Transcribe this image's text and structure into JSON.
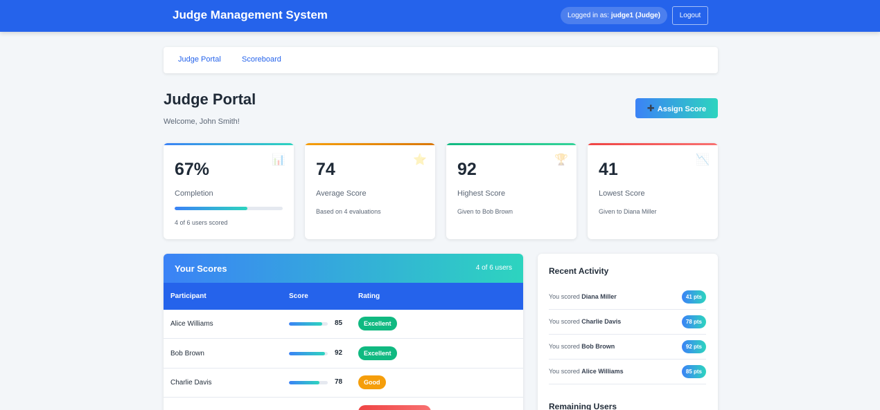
{
  "header": {
    "title": "Judge Management System",
    "logged_in_prefix": "Logged in as:",
    "user": "judge1 (Judge)",
    "logout_label": "Logout"
  },
  "nav": {
    "items": [
      "Judge Portal",
      "Scoreboard"
    ]
  },
  "page": {
    "title": "Judge Portal",
    "welcome": "Welcome, John Smith!",
    "assign_label": "Assign Score",
    "assign_icon": "plus-icon"
  },
  "stats": [
    {
      "value": "67%",
      "label": "Completion",
      "sub": "4 of 6 users scored",
      "icon": "bar-chart-icon",
      "progress": 0.67,
      "accent": "#3b82f6"
    },
    {
      "value": "74",
      "label": "Average Score",
      "sub": "Based on 4 evaluations",
      "icon": "star-icon",
      "accent": "#f59e0b"
    },
    {
      "value": "92",
      "label": "Highest Score",
      "sub": "Given to Bob Brown",
      "icon": "trophy-icon",
      "accent": "#10b981"
    },
    {
      "value": "41",
      "label": "Lowest Score",
      "sub": "Given to Diana Miller",
      "icon": "trend-down-icon",
      "accent": "#ef4444"
    }
  ],
  "scores": {
    "title": "Your Scores",
    "count": "4 of 6 users",
    "columns": [
      "Participant",
      "Score",
      "Rating"
    ],
    "rows": [
      {
        "name": "Alice Williams",
        "score": "85",
        "level": 0.85,
        "rating": "Excellent",
        "rating_color": "#10b981"
      },
      {
        "name": "Bob Brown",
        "score": "92",
        "level": 0.92,
        "rating": "Excellent",
        "rating_color": "#10b981"
      },
      {
        "name": "Charlie Davis",
        "score": "78",
        "level": 0.78,
        "rating": "Good",
        "rating_color": "#f59e0b"
      }
    ]
  },
  "activity": {
    "title": "Recent Activity",
    "prefix": "You scored",
    "items": [
      {
        "name": "Diana Miller",
        "points": "41 pts"
      },
      {
        "name": "Charlie Davis",
        "points": "78 pts"
      },
      {
        "name": "Bob Brown",
        "points": "92 pts"
      },
      {
        "name": "Alice Williams",
        "points": "85 pts"
      }
    ],
    "remaining_title": "Remaining Users"
  }
}
